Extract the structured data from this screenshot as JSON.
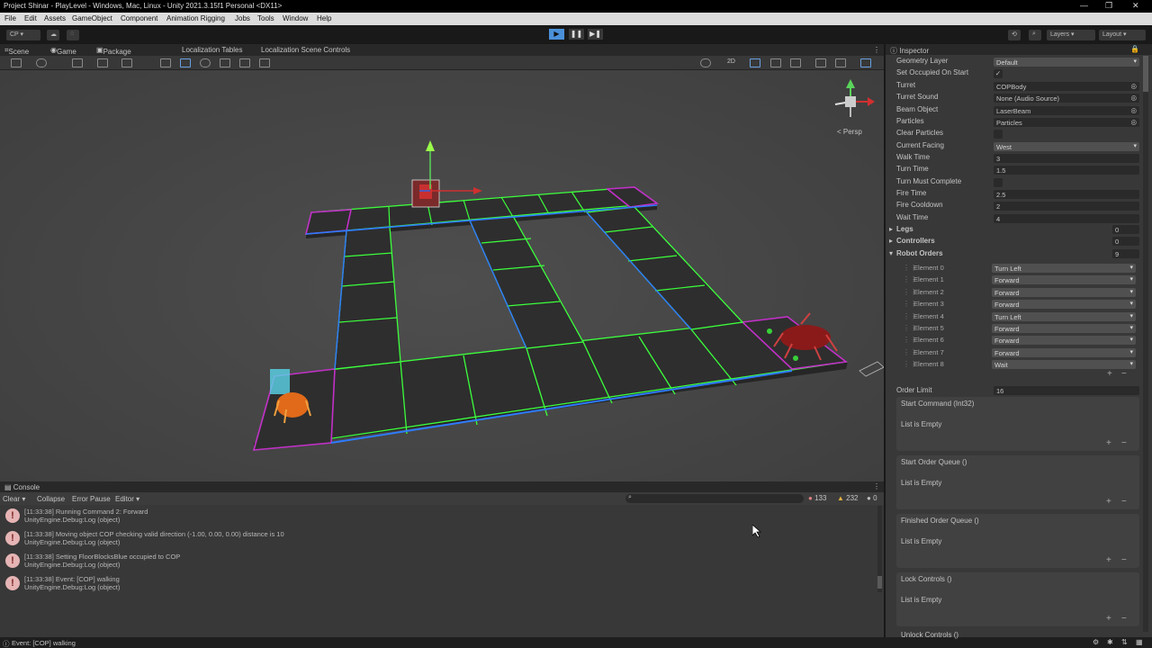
{
  "window": {
    "title": "Project Shinar - PlayLevel - Windows, Mac, Linux - Unity 2021.3.15f1 Personal <DX11>"
  },
  "menu": [
    "File",
    "Edit",
    "Assets",
    "GameObject",
    "Component",
    "Animation Rigging",
    "Jobs",
    "Tools",
    "Window",
    "Help"
  ],
  "toolbar": {
    "account": "CP",
    "layers": "Layers",
    "layout": "Layout",
    "play": "▶",
    "pause": "❚❚",
    "step": "▶❚"
  },
  "scene_tabs": [
    "Scene",
    "Game",
    "Package Manager",
    "Localization Tables",
    "Localization Scene Controls"
  ],
  "scene": {
    "persp_label": "< Persp",
    "mode_2d": "2D"
  },
  "console": {
    "title": "Console",
    "tools": {
      "clear": "Clear",
      "collapse": "Collapse",
      "error_pause": "Error Pause",
      "editor": "Editor"
    },
    "counts": {
      "errors": "133",
      "warnings": "232",
      "info": "0"
    },
    "logs": [
      {
        "line1": "[11:33:38] Running Command 2: Forward",
        "line2": "UnityEngine.Debug:Log (object)"
      },
      {
        "line1": "[11:33:38] Moving object COP checking valid direction (-1.00, 0.00, 0.00) distance is 10",
        "line2": "UnityEngine.Debug:Log (object)"
      },
      {
        "line1": "[11:33:38] Setting FloorBlocksBlue occupied to COP",
        "line2": "UnityEngine.Debug:Log (object)"
      },
      {
        "line1": "[11:33:38] Event: [COP] walking",
        "line2": "UnityEngine.Debug:Log (object)"
      }
    ]
  },
  "statusbar": {
    "text": "Event: [COP] walking"
  },
  "inspector": {
    "title": "Inspector",
    "props": [
      {
        "label": "Geometry Layer",
        "value": "Default",
        "kind": "drop"
      },
      {
        "label": "Set Occupied On Start",
        "value": "✓",
        "kind": "check"
      },
      {
        "label": "Turret",
        "value": "COPBody",
        "kind": "obj"
      },
      {
        "label": "Turret Sound",
        "value": "None (Audio Source)",
        "kind": "obj"
      },
      {
        "label": "Beam Object",
        "value": "LaserBeam",
        "kind": "obj"
      },
      {
        "label": "Particles",
        "value": "Particles",
        "kind": "obj"
      },
      {
        "label": "Clear Particles",
        "value": "",
        "kind": "check"
      },
      {
        "label": "Current Facing",
        "value": "West",
        "kind": "drop"
      },
      {
        "label": "Walk Time",
        "value": "3",
        "kind": "val"
      },
      {
        "label": "Turn Time",
        "value": "1.5",
        "kind": "val"
      },
      {
        "label": "Turn Must Complete",
        "value": "",
        "kind": "check"
      },
      {
        "label": "Fire Time",
        "value": "2.5",
        "kind": "val"
      },
      {
        "label": "Fire Cooldown",
        "value": "2",
        "kind": "val"
      },
      {
        "label": "Wait Time",
        "value": "4",
        "kind": "val"
      }
    ],
    "legs": {
      "label": "Legs",
      "count": "0"
    },
    "controllers": {
      "label": "Controllers",
      "count": "0"
    },
    "robot_orders": {
      "label": "Robot Orders",
      "count": "9"
    },
    "elements": [
      {
        "label": "Element 0",
        "value": "Turn Left"
      },
      {
        "label": "Element 1",
        "value": "Forward"
      },
      {
        "label": "Element 2",
        "value": "Forward"
      },
      {
        "label": "Element 3",
        "value": "Forward"
      },
      {
        "label": "Element 4",
        "value": "Turn Left"
      },
      {
        "label": "Element 5",
        "value": "Forward"
      },
      {
        "label": "Element 6",
        "value": "Forward"
      },
      {
        "label": "Element 7",
        "value": "Forward"
      },
      {
        "label": "Element 8",
        "value": "Wait"
      }
    ],
    "order_limit": {
      "label": "Order Limit",
      "value": "16"
    },
    "lists": [
      {
        "title": "Start Command (Int32)",
        "empty": "List is Empty"
      },
      {
        "title": "Start Order Queue ()",
        "empty": "List is Empty"
      },
      {
        "title": "Finished Order Queue ()",
        "empty": "List is Empty"
      },
      {
        "title": "Lock Controls ()",
        "empty": "List is Empty"
      }
    ],
    "cut_off": "Unlock Controls ()"
  },
  "colors": {
    "accent_play": "#4a90d9",
    "green_edge": "#3cff3c",
    "blue_edge": "#2e7bff",
    "magenta_edge": "#c230c8"
  }
}
